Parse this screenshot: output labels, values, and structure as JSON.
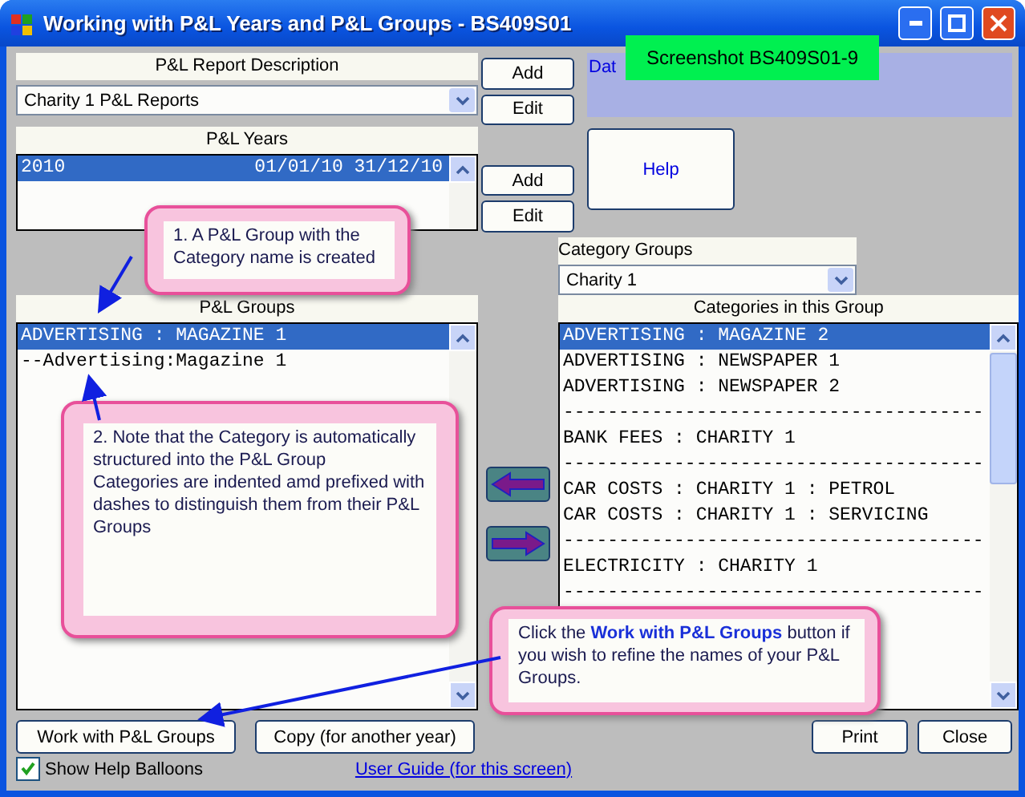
{
  "window": {
    "title": "Working with P&L Years and P&L Groups - BS409S01"
  },
  "screenshot_label": "Screenshot BS409S01-9",
  "report": {
    "heading": "P&L Report Description",
    "value": "Charity 1 P&L Reports",
    "buttons": [
      "Add",
      "Edit"
    ]
  },
  "years": {
    "heading": "P&L Years",
    "rows": [
      {
        "year": "2010",
        "start": "01/01/10",
        "end": "31/12/10",
        "selected": true
      }
    ],
    "buttons": [
      "Add",
      "Edit"
    ]
  },
  "info_panel": {
    "text": "Dat"
  },
  "help_button": "Help",
  "groups": {
    "heading": "P&L Groups",
    "rows": [
      {
        "label": "ADVERTISING : MAGAZINE 1",
        "selected": true
      },
      {
        "label": "--Advertising:Magazine 1",
        "selected": false
      }
    ]
  },
  "category_groups": {
    "heading": "Category Groups",
    "value": "Charity 1"
  },
  "categories": {
    "heading": "Categories in this Group",
    "rows": [
      {
        "label": "ADVERTISING : MAGAZINE 2",
        "selected": true
      },
      {
        "label": "ADVERTISING : NEWSPAPER 1",
        "selected": false
      },
      {
        "label": "ADVERTISING : NEWSPAPER 2",
        "selected": false
      },
      {
        "label": "--------------------------------------",
        "selected": false
      },
      {
        "label": "BANK FEES : CHARITY 1",
        "selected": false
      },
      {
        "label": "--------------------------------------",
        "selected": false
      },
      {
        "label": "CAR COSTS : CHARITY 1 : PETROL",
        "selected": false
      },
      {
        "label": "CAR COSTS : CHARITY 1 : SERVICING",
        "selected": false
      },
      {
        "label": "--------------------------------------",
        "selected": false
      },
      {
        "label": "ELECTRICITY : CHARITY 1",
        "selected": false
      },
      {
        "label": "--------------------------------------",
        "selected": false
      }
    ]
  },
  "footer": {
    "buttons": [
      "Work with P&L Groups",
      "Copy (for another year)",
      "Print",
      "Close"
    ],
    "show_help": {
      "label": "Show Help Balloons",
      "checked": true
    },
    "link": "User Guide (for this screen)"
  },
  "callouts": [
    "1. A P&L Group with the Category name is created",
    "2. Note that the Category is automatically structured into the P&L Group\nCategories are indented amd prefixed with dashes to distinguish them from their P&L Groups",
    "Click the **Work with P&L Groups** button if you wish to refine the names of your P&L Groups."
  ]
}
